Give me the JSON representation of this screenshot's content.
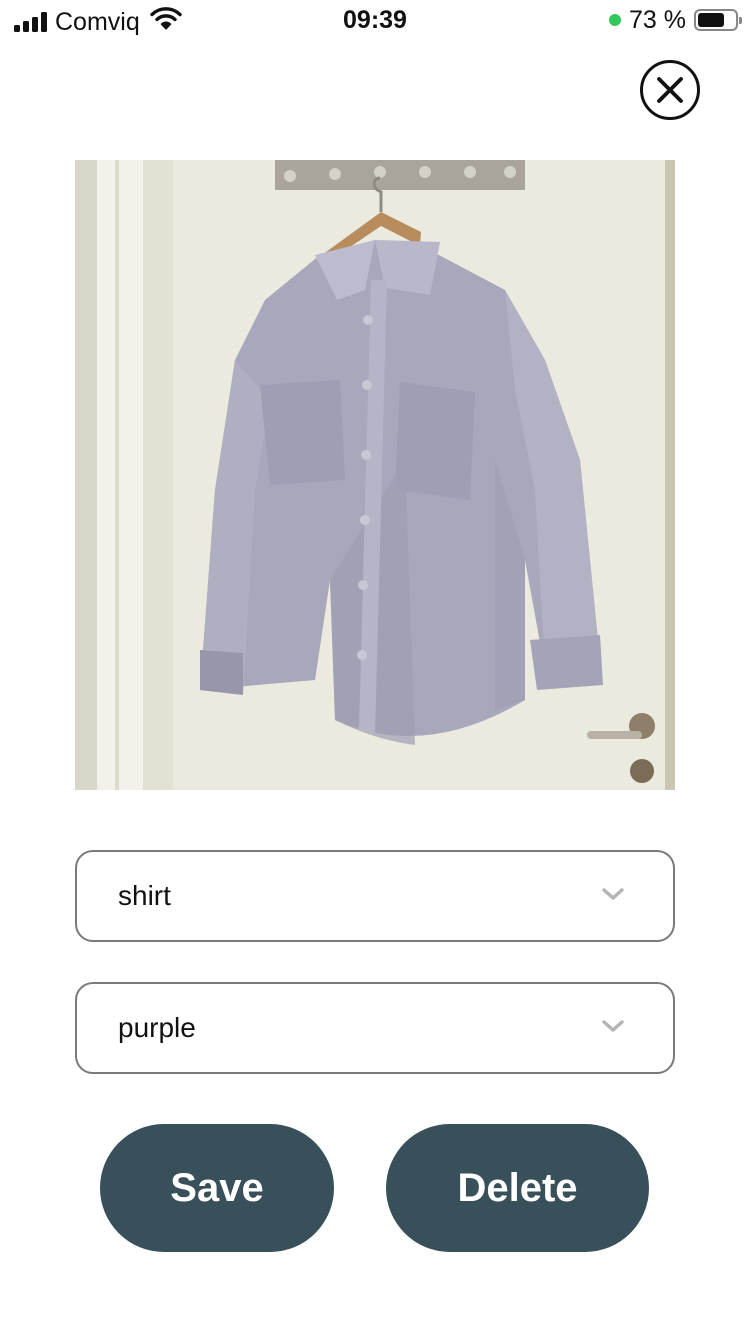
{
  "status_bar": {
    "carrier": "Comviq",
    "time": "09:39",
    "battery_percent": "73 %",
    "battery_level": 0.73,
    "indicator_color": "#34c759"
  },
  "close_button": {
    "icon": "close-icon"
  },
  "photo": {
    "subject": "shirt-photo"
  },
  "form": {
    "category_value": "shirt",
    "color_value": "purple"
  },
  "actions": {
    "save_label": "Save",
    "delete_label": "Delete"
  },
  "colors": {
    "button_bg": "#375059",
    "button_text": "#ffffff",
    "field_border": "#7a7a7a"
  }
}
